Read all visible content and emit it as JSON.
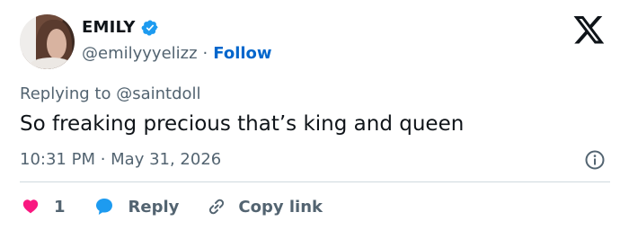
{
  "author": {
    "name": "EMILY",
    "handle": "@emilyyyelizz",
    "separator": "·",
    "follow_label": "Follow"
  },
  "brand_icon": "x-logo-icon",
  "reply_context": {
    "text": "Replying to @saintdoll"
  },
  "tweet": {
    "text": "So freaking precious that’s king and queen",
    "timestamp": "10:31 PM · May 31, 2026"
  },
  "actions": {
    "like_count": "1",
    "reply_label": "Reply",
    "copy_link_label": "Copy link"
  },
  "colors": {
    "verified": "#1d9bf0",
    "follow": "#0066cc",
    "like": "#f91880",
    "reply": "#1d9bf0",
    "muted_text": "#536471"
  }
}
